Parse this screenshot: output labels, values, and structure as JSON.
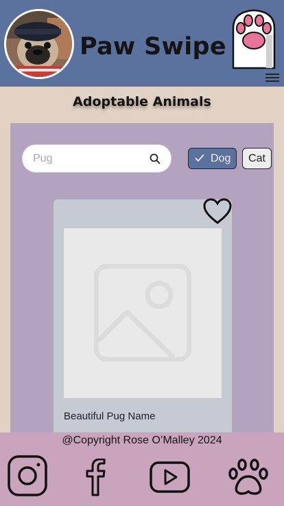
{
  "header": {
    "title": "Paw Swipe",
    "avatar_alt": "pug-avatar",
    "logo_icon": "paw-card-icon",
    "menu_icon": "hamburger-menu-icon"
  },
  "main": {
    "section_title": "Adoptable Animals",
    "search": {
      "placeholder": "Pug",
      "value": ""
    },
    "filters": [
      {
        "label": "Dog",
        "selected": true
      },
      {
        "label": "Cat",
        "selected": false
      }
    ],
    "card": {
      "name": "Beautiful Pug Name",
      "favorite_icon": "heart-outline-icon",
      "image_icon": "image-placeholder-icon"
    }
  },
  "footer": {
    "copyright": "@Copyright Rose O’Malley 2024",
    "social": [
      "instagram-icon",
      "facebook-icon",
      "youtube-icon",
      "paw-icon"
    ]
  },
  "colors": {
    "header_bg": "#5c729e",
    "page_bg": "#e2d2c6",
    "panel_bg": "#b3a3c1",
    "card_bg": "#c6cad3",
    "footer_bg": "#c9a4bc",
    "paw_pink": "#e9749a"
  }
}
